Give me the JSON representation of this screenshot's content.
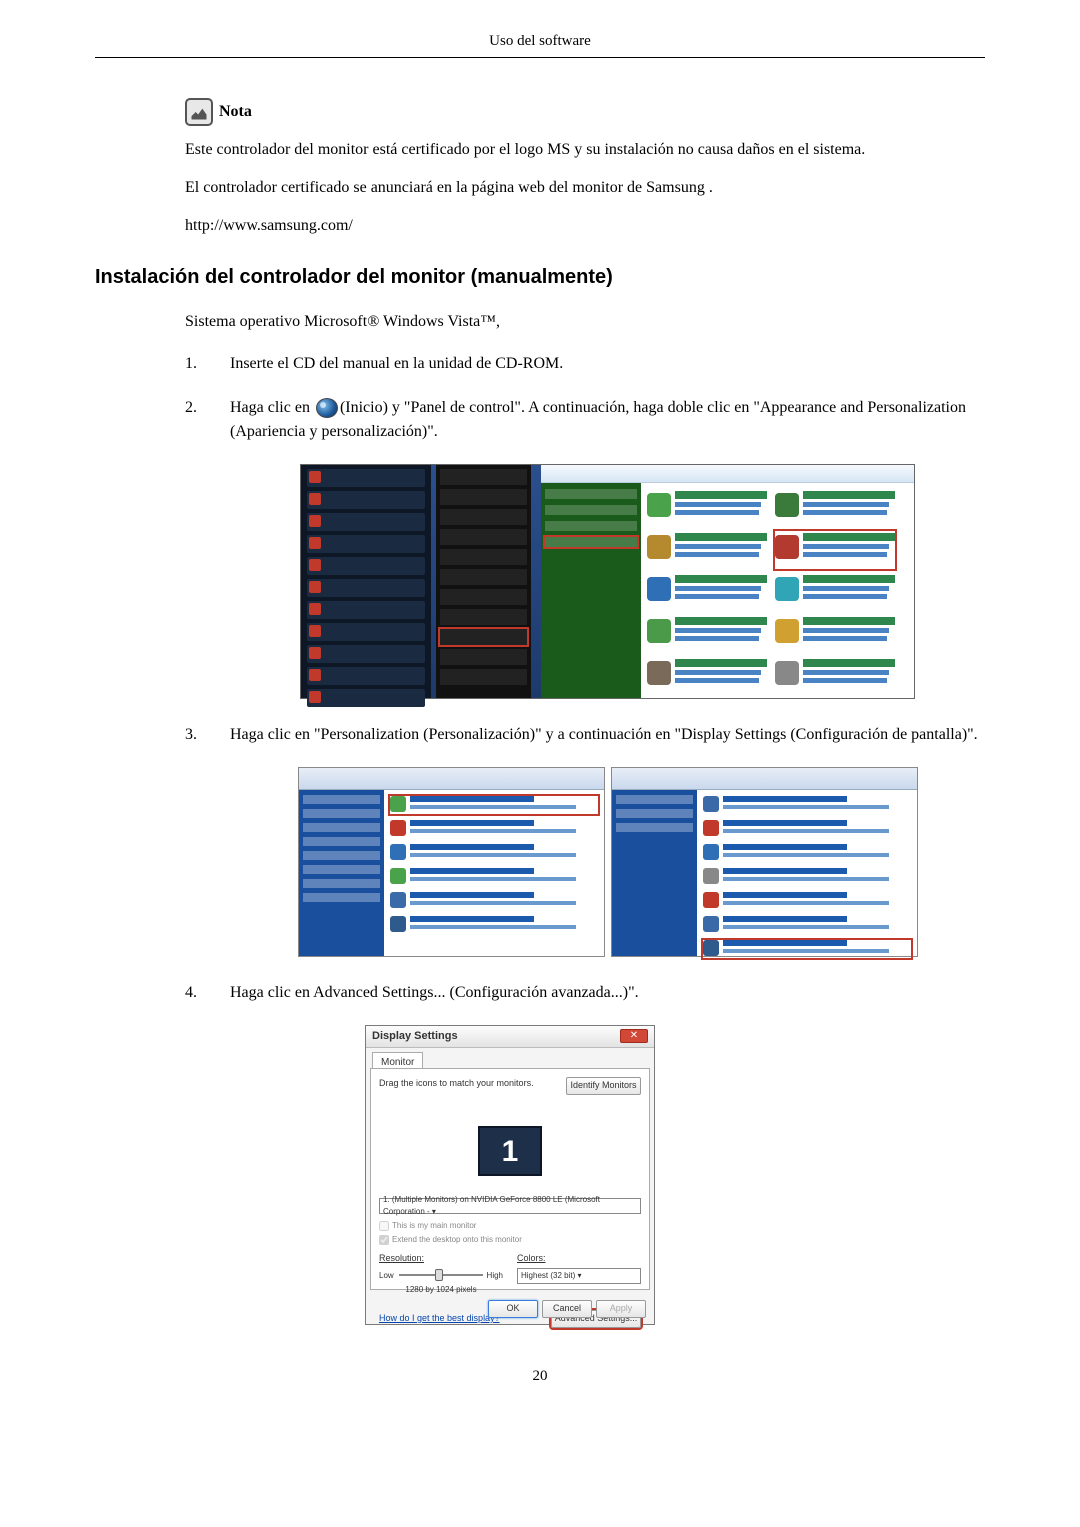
{
  "header": {
    "title": "Uso del software"
  },
  "note": {
    "label": "Nota",
    "p1": "Este controlador del monitor está certificado por el logo MS y su instalación no causa daños en el sistema.",
    "p2": "El controlador certificado se anunciará en la página web del monitor de Samsung .",
    "url": "http://www.samsung.com/"
  },
  "section": {
    "heading": "Instalación del controlador del monitor (manualmente)",
    "intro": "Sistema operativo Microsoft® Windows Vista™,",
    "steps": {
      "s1": "Inserte el CD del manual en la unidad de CD-ROM.",
      "s2a": "Haga clic en ",
      "s2b": "(Inicio) y \"Panel de control\". A continuación, haga doble clic en \"Appearance and Personalization (Apariencia y personalización)\".",
      "s3": "Haga clic en \"Personalization (Personalización)\" y a continuación en \"Display Settings (Configuración de pantalla)\".",
      "s4": "Haga clic en Advanced Settings... (Configuración avanzada...)\"."
    }
  },
  "display_settings": {
    "title": "Display Settings",
    "tab": "Monitor",
    "drag_text": "Drag the icons to match your monitors.",
    "identify": "Identify Monitors",
    "monitor_number": "1",
    "select_text": "1. (Multiple Monitors) on NVIDIA GeForce 8800 LE (Microsoft Corporation - ▾",
    "check1": "This is my main monitor",
    "check2": "Extend the desktop onto this monitor",
    "resolution_label": "Resolution:",
    "low": "Low",
    "high": "High",
    "resolution_value": "1280 by 1024 pixels",
    "colors_label": "Colors:",
    "colors_value": "Highest (32 bit)    ▾",
    "help_link": "How do I get the best display?",
    "advanced": "Advanced Settings...",
    "ok": "OK",
    "cancel": "Cancel",
    "apply": "Apply"
  },
  "page_number": "20"
}
